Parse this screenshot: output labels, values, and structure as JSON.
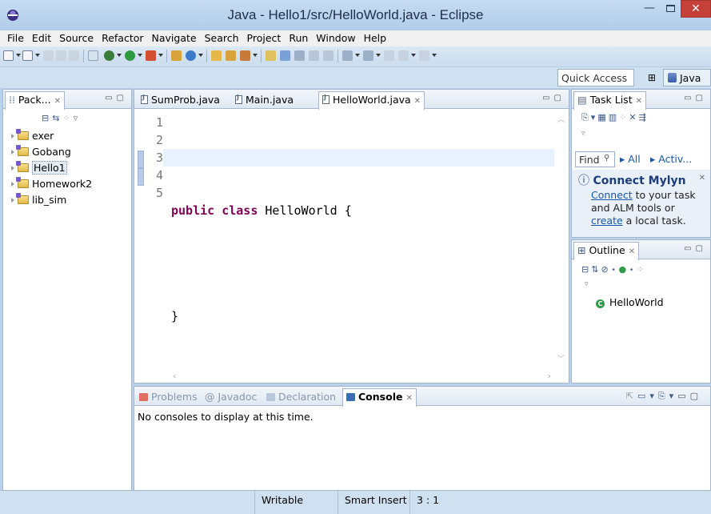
{
  "window": {
    "title": "Java - Hello1/src/HelloWorld.java - Eclipse",
    "minimize": "—",
    "close": "✕"
  },
  "menu": [
    "File",
    "Edit",
    "Source",
    "Refactor",
    "Navigate",
    "Search",
    "Project",
    "Run",
    "Window",
    "Help"
  ],
  "quick_access": {
    "placeholder": "Quick Access"
  },
  "perspective": {
    "label": "Java"
  },
  "package_explorer": {
    "tab_label": "Pack...",
    "close": "✕",
    "projects": [
      {
        "name": "exer",
        "selected": false
      },
      {
        "name": "Gobang",
        "selected": false
      },
      {
        "name": "Hello1",
        "selected": true
      },
      {
        "name": "Homework2",
        "selected": false
      },
      {
        "name": "lib_sim",
        "selected": false
      }
    ]
  },
  "editor": {
    "tabs": [
      {
        "label": "SumProb.java",
        "active": false
      },
      {
        "label": "Main.java",
        "active": false
      },
      {
        "label": "HelloWorld.java",
        "active": true
      }
    ],
    "close": "✕",
    "line_numbers": [
      "1",
      "2",
      "3",
      "4",
      "5"
    ],
    "code": {
      "line2_keyword1": "public",
      "line2_keyword2": "class",
      "line2_rest": " HelloWorld {",
      "line4": "}"
    }
  },
  "task_list": {
    "tab_label": "Task List",
    "close": "✕",
    "find_placeholder": "Find",
    "all_label": "All",
    "activate_label": "Activ...",
    "mylyn": {
      "title": "Connect Mylyn",
      "connect_link": "Connect",
      "text1": " to your task and ALM tools or ",
      "create_link": "create",
      "text2": " a local task."
    }
  },
  "outline": {
    "tab_label": "Outline",
    "close": "✕",
    "item": "HelloWorld"
  },
  "console": {
    "tabs": [
      {
        "label": "Problems",
        "active": false
      },
      {
        "label": "Javadoc",
        "active": false
      },
      {
        "label": "Declaration",
        "active": false
      },
      {
        "label": "Console",
        "active": true
      }
    ],
    "close": "✕",
    "message": "No consoles to display at this time."
  },
  "status": {
    "writable": "Writable",
    "insert_mode": "Smart Insert",
    "position": "3 : 1"
  },
  "colors": {
    "keyword": "#7f0055",
    "current_line": "#e8f2fe",
    "link": "#1a56a8",
    "close_button": "#c6403a"
  }
}
